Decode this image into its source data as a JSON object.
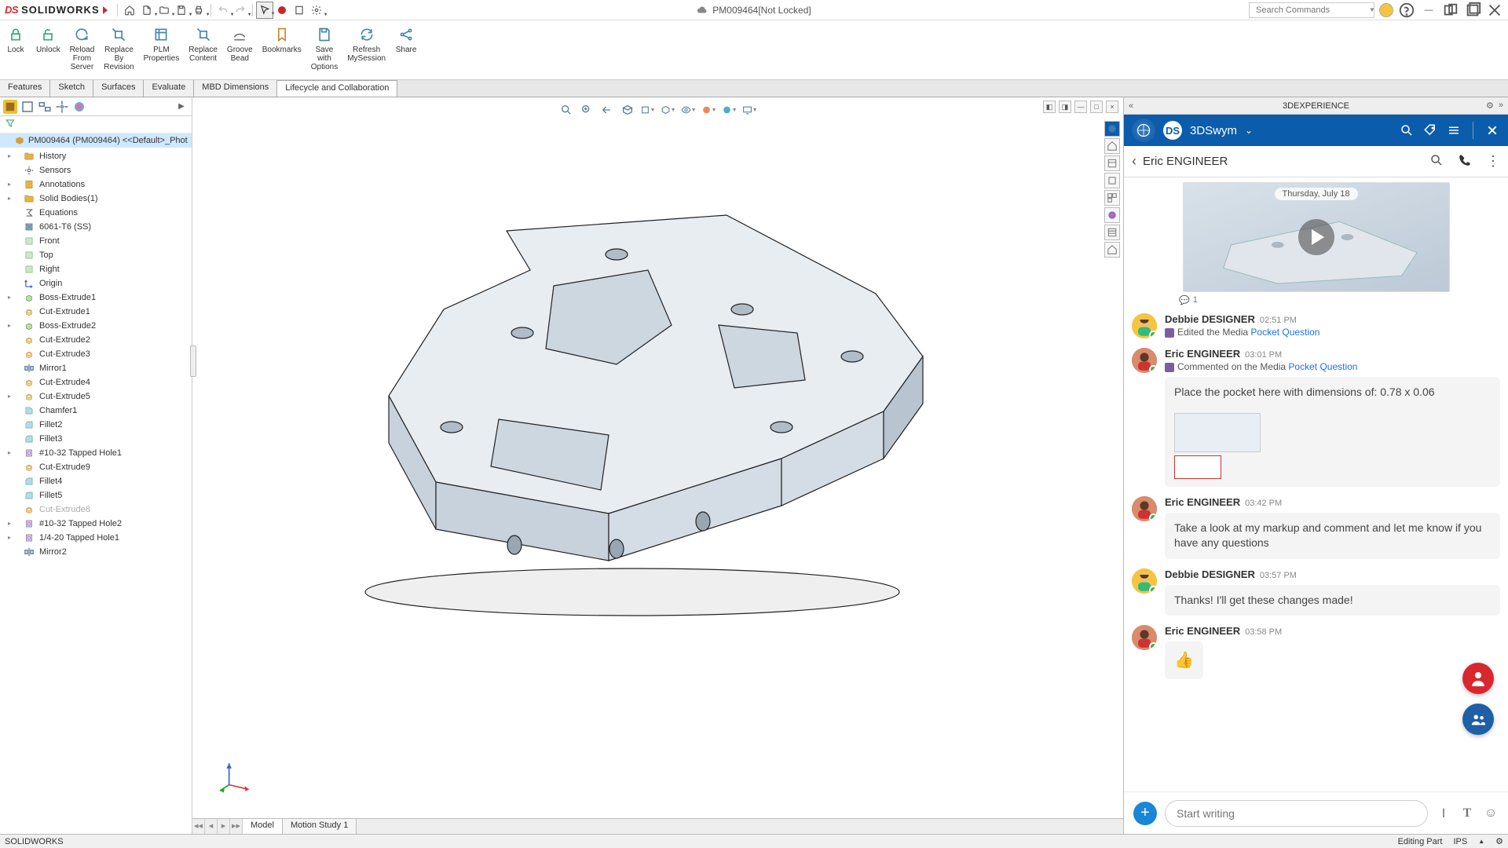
{
  "app": {
    "name": "SOLIDWORKS",
    "doc_title": "PM009464[Not Locked]"
  },
  "search_placeholder": "Search Commands",
  "ribbon": [
    {
      "label": "Lock"
    },
    {
      "label": "Unlock"
    },
    {
      "label": "Reload\nFrom\nServer"
    },
    {
      "label": "Replace\nBy\nRevision"
    },
    {
      "label": "PLM\nProperties"
    },
    {
      "label": "Replace\nContent"
    },
    {
      "label": "Groove\nBead"
    },
    {
      "label": "Bookmarks"
    },
    {
      "label": "Save\nwith\nOptions"
    },
    {
      "label": "Refresh\nMySession"
    },
    {
      "label": "Share"
    }
  ],
  "tabs": [
    "Features",
    "Sketch",
    "Surfaces",
    "Evaluate",
    "MBD Dimensions",
    "Lifecycle and Collaboration"
  ],
  "active_tab": 5,
  "tree_root": "PM009464 (PM009464) <<Default>_Phot",
  "tree": [
    {
      "label": "History",
      "caret": true,
      "icon": "folder"
    },
    {
      "label": "Sensors",
      "icon": "sensor"
    },
    {
      "label": "Annotations",
      "caret": true,
      "icon": "note"
    },
    {
      "label": "Solid Bodies(1)",
      "caret": true,
      "icon": "folder"
    },
    {
      "label": "Equations",
      "icon": "sigma"
    },
    {
      "label": "6061-T6 (SS)",
      "icon": "material"
    },
    {
      "label": "Front",
      "icon": "plane"
    },
    {
      "label": "Top",
      "icon": "plane"
    },
    {
      "label": "Right",
      "icon": "plane"
    },
    {
      "label": "Origin",
      "icon": "origin"
    },
    {
      "label": "Boss-Extrude1",
      "caret": true,
      "icon": "extrude"
    },
    {
      "label": "Cut-Extrude1",
      "icon": "cut"
    },
    {
      "label": "Boss-Extrude2",
      "caret": true,
      "icon": "extrude"
    },
    {
      "label": "Cut-Extrude2",
      "icon": "cut"
    },
    {
      "label": "Cut-Extrude3",
      "icon": "cut"
    },
    {
      "label": "Mirror1",
      "icon": "mirror"
    },
    {
      "label": "Cut-Extrude4",
      "icon": "cut"
    },
    {
      "label": "Cut-Extrude5",
      "caret": true,
      "icon": "cut"
    },
    {
      "label": "Chamfer1",
      "icon": "chamfer"
    },
    {
      "label": "Fillet2",
      "icon": "fillet"
    },
    {
      "label": "Fillet3",
      "icon": "fillet"
    },
    {
      "label": "#10-32 Tapped Hole1",
      "caret": true,
      "icon": "hole"
    },
    {
      "label": "Cut-Extrude9",
      "icon": "cut"
    },
    {
      "label": "Fillet4",
      "icon": "fillet"
    },
    {
      "label": "Fillet5",
      "icon": "fillet"
    },
    {
      "label": "Cut-Extrude8",
      "icon": "cut",
      "disabled": true
    },
    {
      "label": "#10-32 Tapped Hole2",
      "caret": true,
      "icon": "hole"
    },
    {
      "label": "1/4-20 Tapped Hole1",
      "caret": true,
      "icon": "hole"
    },
    {
      "label": "Mirror2",
      "icon": "mirror"
    }
  ],
  "bottom_tabs": [
    "Model",
    "Motion Study 1"
  ],
  "active_bottom_tab": 0,
  "status": {
    "left": "SOLIDWORKS",
    "center": "Editing Part",
    "units": "IPS"
  },
  "chat": {
    "panel_title": "3DEXPERIENCE",
    "app": "3DSwym",
    "contact": "Eric ENGINEER",
    "media_date": "Thursday, July 18",
    "thumb_count": "1",
    "messages": [
      {
        "av": "debbie",
        "name": "Debbie DESIGNER",
        "time": "02:51 PM",
        "action_prefix": "Edited the Media ",
        "action_link": "Pocket Question"
      },
      {
        "av": "eric",
        "name": "Eric ENGINEER",
        "time": "03:01 PM",
        "action_prefix": "Commented on the Media ",
        "action_link": "Pocket Question",
        "bubble": "Place the pocket here with dimensions of:  0.78 x 0.06",
        "has_thumbs": true
      },
      {
        "av": "eric",
        "name": "Eric ENGINEER",
        "time": "03:42 PM",
        "bubble": "Take a look at my markup and comment and let me know if you have any questions"
      },
      {
        "av": "debbie",
        "name": "Debbie DESIGNER",
        "time": "03:57 PM",
        "bubble": "Thanks!  I'll get these changes made!"
      },
      {
        "av": "eric",
        "name": "Eric ENGINEER",
        "time": "03:58 PM",
        "emoji": "👍"
      }
    ],
    "input_placeholder": "Start writing"
  }
}
